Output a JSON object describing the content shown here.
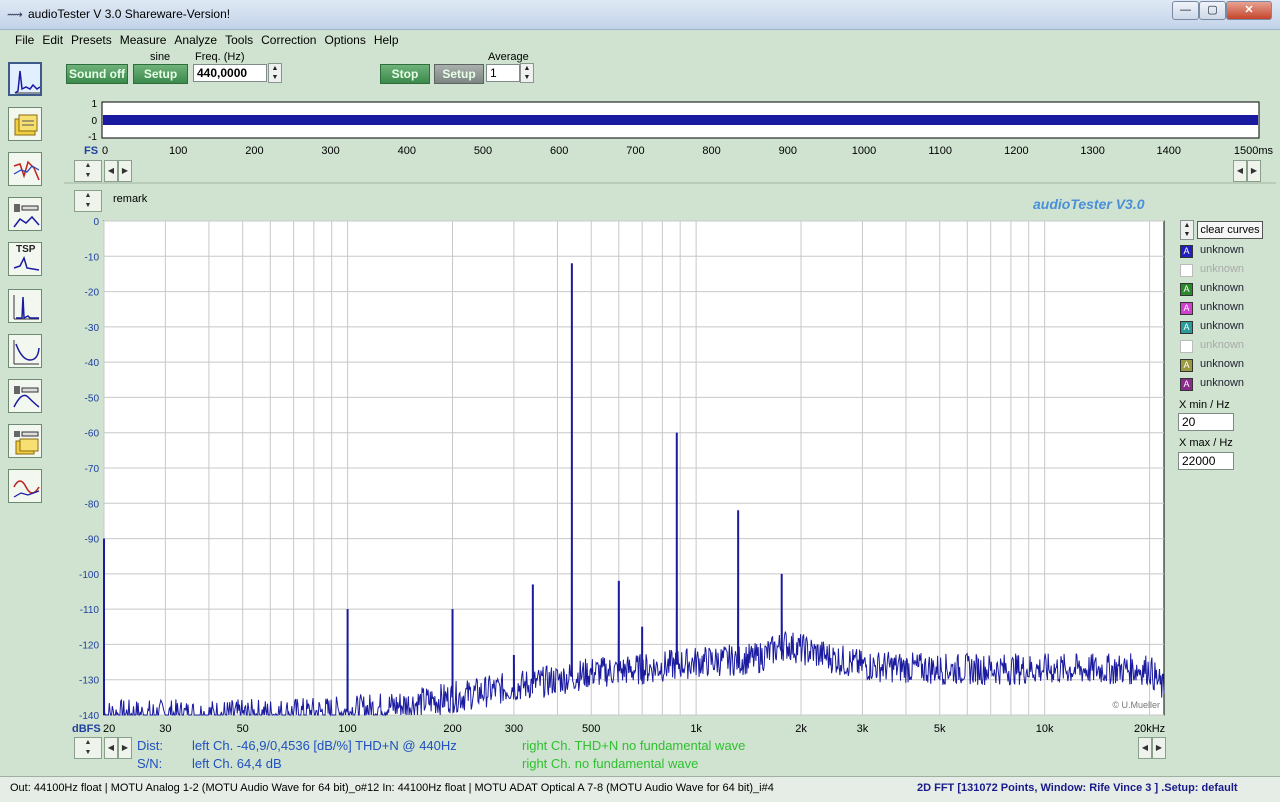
{
  "window": {
    "title": "audioTester  V 3.0 Shareware-Version!",
    "minimize": "—",
    "maximize": "▢",
    "close": "✕"
  },
  "menu": [
    "File",
    "Edit",
    "Presets",
    "Measure",
    "Analyze",
    "Tools",
    "Correction",
    "Options",
    "Help"
  ],
  "sidebar": {
    "tools": [
      {
        "icon": "spectrum-icon"
      },
      {
        "icon": "folder-icon"
      },
      {
        "icon": "frequency-response-icon"
      },
      {
        "icon": "speaker-measure-icon"
      },
      {
        "icon": "tsp-icon",
        "label": "TSP"
      },
      {
        "icon": "impulse-icon"
      },
      {
        "icon": "curve-icon"
      },
      {
        "icon": "speaker-response-icon"
      },
      {
        "icon": "speaker-files-icon"
      },
      {
        "icon": "sine-analysis-icon"
      }
    ]
  },
  "generator": {
    "sound_label": "Sound off",
    "wave_label": "sine",
    "setup_label": "Setup",
    "freq_label": "Freq. (Hz)",
    "freq_value": "440,0000"
  },
  "analyzer": {
    "stop_label": "Stop",
    "setup_label": "Setup",
    "average_label": "Average",
    "average_value": "1"
  },
  "scope": {
    "fs_label": "FS",
    "y_ticks": [
      "1",
      "0",
      "-1"
    ],
    "x_ticks": [
      "0",
      "100",
      "200",
      "300",
      "400",
      "500",
      "600",
      "700",
      "800",
      "900",
      "1000",
      "1100",
      "1200",
      "1300",
      "1400",
      "1500ms"
    ],
    "trace_color": "#1a1aa0"
  },
  "spectrum": {
    "remark": "remark",
    "brand": "audioTester  V3.0",
    "copyright": "© U.Mueller",
    "y_unit": "dBFS"
  },
  "chart_data": {
    "type": "line",
    "title": "",
    "xlabel": "",
    "ylabel": "dBFS",
    "x_scale": "log",
    "xlim": [
      20,
      22000
    ],
    "ylim": [
      -140,
      0
    ],
    "x_ticks": [
      20,
      30,
      50,
      100,
      200,
      300,
      500,
      1000,
      2000,
      3000,
      5000,
      10000,
      20000
    ],
    "x_tick_labels": [
      "20",
      "30",
      "50",
      "100",
      "200",
      "300",
      "500",
      "1k",
      "2k",
      "3k",
      "5k",
      "10k",
      "20kHz"
    ],
    "y_ticks": [
      0,
      -10,
      -20,
      -30,
      -40,
      -50,
      -60,
      -70,
      -80,
      -90,
      -100,
      -110,
      -120,
      -130,
      -140
    ],
    "grid": true,
    "series": [
      {
        "color": "#1a1aa0",
        "floor": [
          [
            20,
            -140
          ],
          [
            50,
            -140
          ],
          [
            100,
            -139
          ],
          [
            150,
            -137
          ],
          [
            200,
            -135
          ],
          [
            300,
            -132
          ],
          [
            400,
            -130
          ],
          [
            500,
            -128
          ],
          [
            700,
            -127
          ],
          [
            1000,
            -125
          ],
          [
            1500,
            -124
          ],
          [
            1800,
            -120
          ],
          [
            2500,
            -124
          ],
          [
            3000,
            -126
          ],
          [
            5000,
            -127
          ],
          [
            10000,
            -127
          ],
          [
            15000,
            -127
          ],
          [
            20000,
            -127
          ],
          [
            22000,
            -133
          ]
        ],
        "peaks": [
          [
            20,
            -90
          ],
          [
            100,
            -110
          ],
          [
            200,
            -110
          ],
          [
            300,
            -123
          ],
          [
            340,
            -103
          ],
          [
            440,
            -12
          ],
          [
            600,
            -102
          ],
          [
            700,
            -115
          ],
          [
            880,
            -60
          ],
          [
            1320,
            -82
          ],
          [
            1760,
            -100
          ]
        ]
      }
    ]
  },
  "curves": {
    "clear_label": "clear curves",
    "items": [
      {
        "label": "unknown",
        "color": "#2020c0",
        "enabled": true
      },
      {
        "label": "unknown",
        "color": "#ffffff",
        "enabled": false
      },
      {
        "label": "unknown",
        "color": "#2a8a2a",
        "enabled": true
      },
      {
        "label": "unknown",
        "color": "#d040d0",
        "enabled": true
      },
      {
        "label": "unknown",
        "color": "#2a9a9a",
        "enabled": true
      },
      {
        "label": "unknown",
        "color": "#ffffff",
        "enabled": false
      },
      {
        "label": "unknown",
        "color": "#9a9a40",
        "enabled": true
      },
      {
        "label": "unknown",
        "color": "#8a2a8a",
        "enabled": true
      }
    ],
    "xmin_label": "X min / Hz",
    "xmin_value": "20",
    "xmax_label": "X max / Hz",
    "xmax_value": "22000"
  },
  "results": {
    "dist_label": "Dist:",
    "dist_left": "left Ch. -46,9/0,4536 [dB/%] THD+N  @ 440Hz",
    "dist_right": "right Ch. THD+N  no fundamental wave",
    "sn_label": "S/N:",
    "sn_left": "left Ch. 64,4 dB",
    "sn_right": "right Ch.  no fundamental wave"
  },
  "status": {
    "left": "Out: 44100Hz float  | MOTU Analog 1-2 (MOTU Audio Wave for 64 bit)_o#12  In: 44100Hz float  | MOTU ADAT Optical A 7-8 (MOTU Audio Wave for 64 bit)_i#4",
    "right": "2D FFT [131072 Points, Window: Rife Vince 3 ]  .Setup:  default"
  }
}
